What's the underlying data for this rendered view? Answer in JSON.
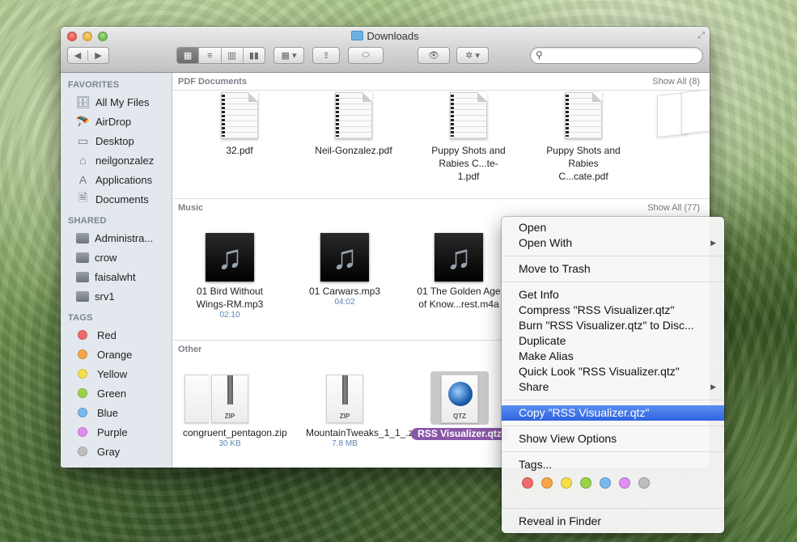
{
  "window": {
    "title": "Downloads",
    "toolbar": {
      "back": "◀",
      "forward": "▶",
      "views": [
        "icon-view",
        "list-view",
        "column-view",
        "coverflow-view"
      ],
      "view_glyphs": [
        "▦",
        "≡",
        "▥",
        "▮▮"
      ],
      "arrange_glyph": "▦ ▾",
      "share_glyph": "⇪",
      "tag_glyph": "⬭",
      "quicklook_glyph": "👁",
      "action_glyph": "✲ ▾",
      "search_placeholder": "",
      "search_value": ""
    }
  },
  "sidebar": {
    "favorites_label": "FAVORITES",
    "favorites": [
      {
        "label": "All My Files",
        "icon": "🗄"
      },
      {
        "label": "AirDrop",
        "icon": "🪂"
      },
      {
        "label": "Desktop",
        "icon": "▭"
      },
      {
        "label": "neilgonzalez",
        "icon": "⌂"
      },
      {
        "label": "Applications",
        "icon": "A"
      },
      {
        "label": "Documents",
        "icon": "🗎"
      }
    ],
    "shared_label": "SHARED",
    "shared": [
      {
        "label": "Administra..."
      },
      {
        "label": "crow"
      },
      {
        "label": "faisalwht"
      },
      {
        "label": "srv1"
      }
    ],
    "tags_label": "TAGS",
    "tags": [
      {
        "label": "Red",
        "color": "#ef6a6a"
      },
      {
        "label": "Orange",
        "color": "#f5a746"
      },
      {
        "label": "Yellow",
        "color": "#f6dd4a"
      },
      {
        "label": "Green",
        "color": "#9ad24a"
      },
      {
        "label": "Blue",
        "color": "#7ab8f0"
      },
      {
        "label": "Purple",
        "color": "#df8ef0"
      },
      {
        "label": "Gray",
        "color": "#bdbdbd"
      }
    ]
  },
  "sections": {
    "pdf": {
      "title": "PDF Documents",
      "show_all": "Show All (8)",
      "items": [
        {
          "name": "32.pdf"
        },
        {
          "name": "Neil-Gonzalez.pdf"
        },
        {
          "name": "Puppy Shots and Rabies C...te-1.pdf"
        },
        {
          "name": "Puppy Shots and Rabies C...cate.pdf"
        }
      ]
    },
    "music": {
      "title": "Music",
      "show_all": "Show All (77)",
      "items": [
        {
          "name": "01 Bird Without Wings-RM.mp3",
          "meta": "02:10"
        },
        {
          "name": "01 Carwars.mp3",
          "meta": "04:02"
        },
        {
          "name": "01 The Golden Age of Know...rest.m4a",
          "meta": ""
        }
      ]
    },
    "other": {
      "title": "Other",
      "items": [
        {
          "name": "congruent_pentagon.zip",
          "meta": "30 KB",
          "badge": "ZIP"
        },
        {
          "name": "MountainTweaks_1_1_.zip",
          "meta": "7.8 MB",
          "badge": "ZIP"
        },
        {
          "name": "RSS Visualizer.qtz",
          "meta": "",
          "badge": "QTZ",
          "selected": true
        }
      ]
    }
  },
  "context_menu": {
    "groups": [
      [
        {
          "label": "Open"
        },
        {
          "label": "Open With",
          "submenu": true
        }
      ],
      [
        {
          "label": "Move to Trash"
        }
      ],
      [
        {
          "label": "Get Info"
        },
        {
          "label": "Compress \"RSS Visualizer.qtz\""
        },
        {
          "label": "Burn \"RSS Visualizer.qtz\" to Disc..."
        },
        {
          "label": "Duplicate"
        },
        {
          "label": "Make Alias"
        },
        {
          "label": "Quick Look \"RSS Visualizer.qtz\""
        },
        {
          "label": "Share",
          "submenu": true
        }
      ],
      [
        {
          "label": "Copy \"RSS Visualizer.qtz\"",
          "highlighted": true
        }
      ],
      [
        {
          "label": "Show View Options"
        }
      ],
      [
        {
          "label": "Tags..."
        }
      ],
      [
        {
          "label": "Reveal in Finder"
        }
      ]
    ],
    "submenu_glyph": "▶",
    "tag_colors": [
      "#ef6a6a",
      "#f5a746",
      "#f6dd4a",
      "#9ad24a",
      "#7ab8f0",
      "#df8ef0",
      "#bdbdbd"
    ],
    "tag_names": [
      "red",
      "orange",
      "yellow",
      "green",
      "blue",
      "purple",
      "gray"
    ]
  }
}
